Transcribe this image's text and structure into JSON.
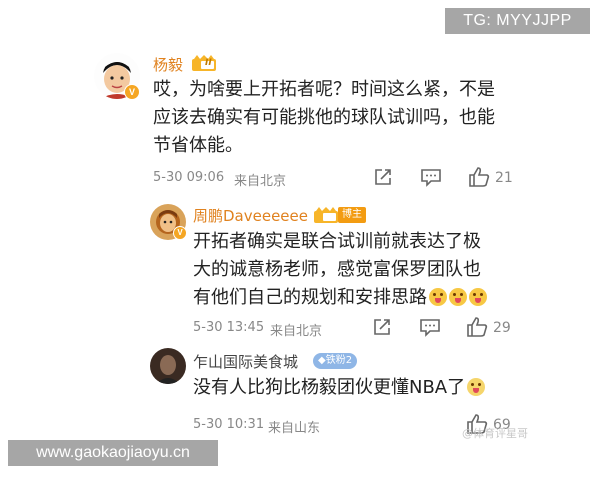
{
  "watermarks": {
    "tg": "TG: MYYJJPP",
    "site": "www.gaokaojiaoyu.cn",
    "weibo": "@体育评星哥"
  },
  "comments": [
    {
      "name": "杨毅",
      "level_badge": "II",
      "text_lines": [
        "哎，为啥要上开拓者呢？时间这么紧，不是",
        "应该去确实有可能挑他的球队试训吗，也能",
        "节省体能。"
      ],
      "time": "5-30 09:06",
      "location": "来自北京",
      "likes": "21"
    },
    {
      "name": "周鹏Daveeeeee",
      "tag": "博主",
      "text_lines": [
        "开拓者确实是联合试训前就表达了极",
        "大的诚意杨老师，感觉富保罗团队也",
        "有他们自己的规划和安排思路"
      ],
      "time": "5-30 13:45",
      "location": "来自北京",
      "likes": "29"
    },
    {
      "name": "乍山国际美食城",
      "tag": "铁粉2",
      "text_lines": [
        "没有人比狗比杨毅团伙更懂NBA了"
      ],
      "time": "5-30 10:31",
      "location": "来自山东",
      "likes": "69"
    }
  ],
  "icons": [
    "share-icon",
    "comment-icon",
    "like-icon",
    "crown-icon",
    "verified-icon",
    "emoji-icon"
  ],
  "colors": {
    "name": "#e0821f",
    "name_blue": "#2b6aa8",
    "meta": "#888888",
    "badge": "#f5a623"
  }
}
